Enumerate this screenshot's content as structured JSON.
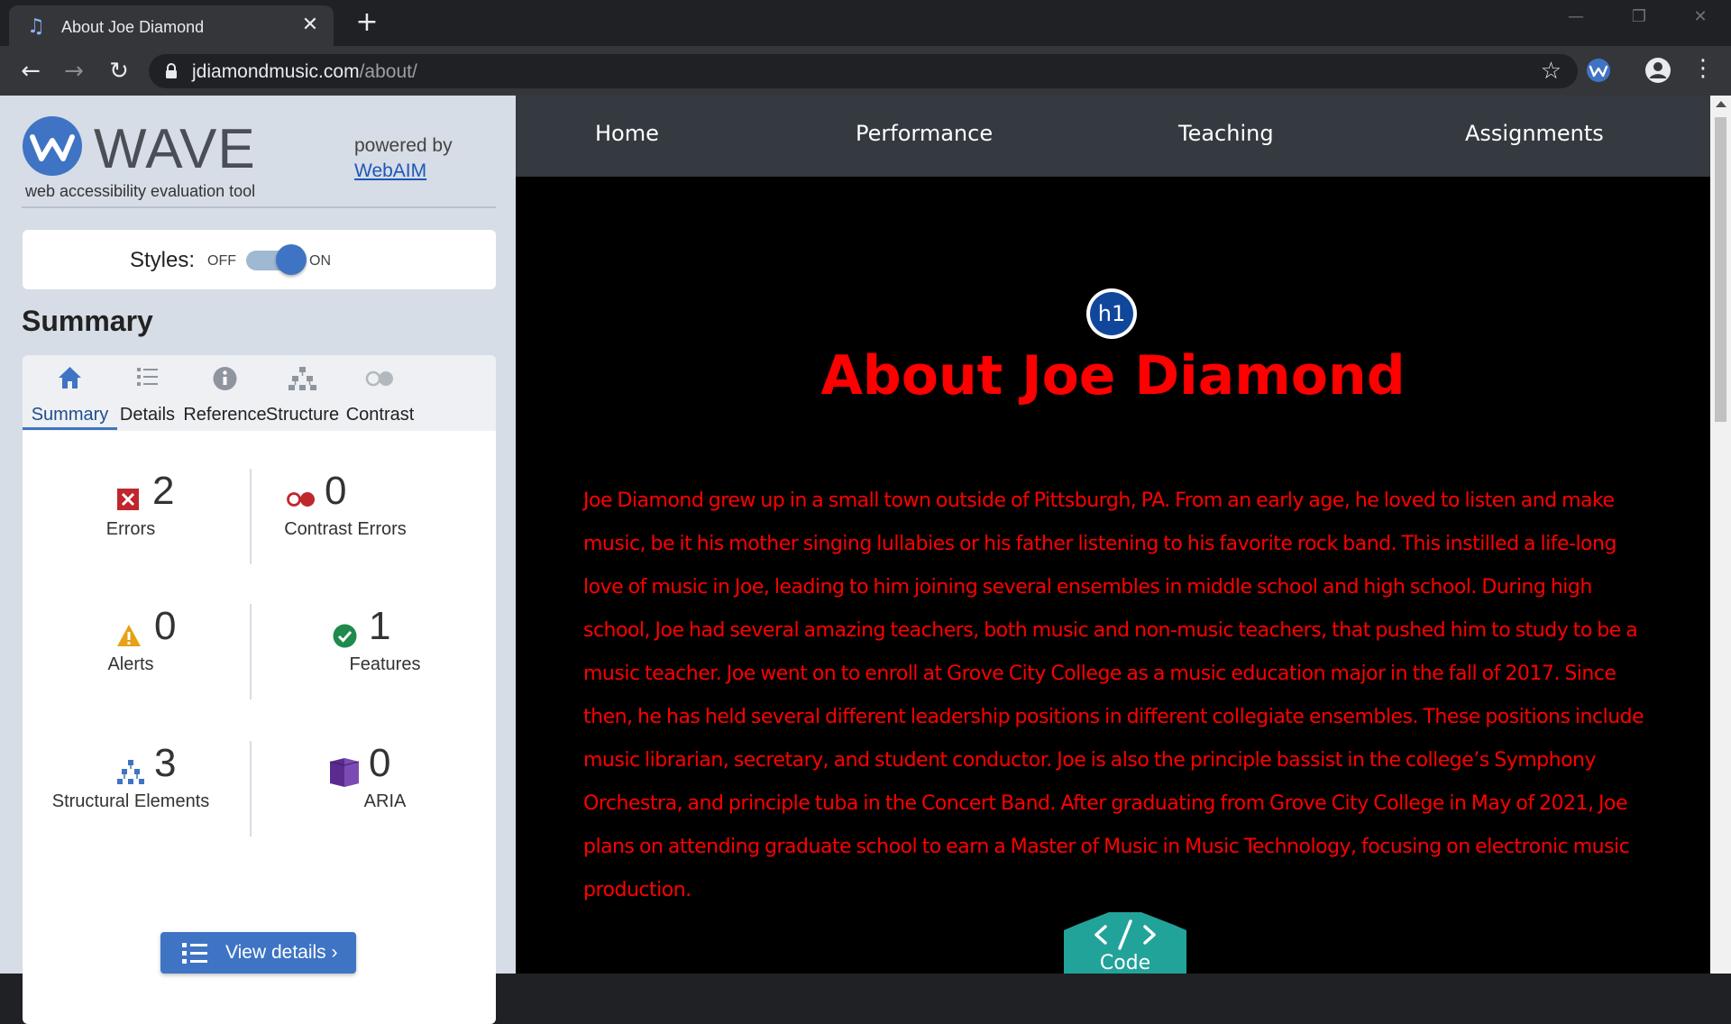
{
  "browser": {
    "tab_title": "About Joe Diamond",
    "url_host": "jdiamondmusic.com",
    "url_path": "/about/"
  },
  "wave": {
    "wordmark": "WAVE",
    "tagline": "web accessibility evaluation tool",
    "powered_by": "powered by",
    "webaim_link": "WebAIM",
    "styles_label": "Styles:",
    "styles_off": "OFF",
    "styles_on": "ON",
    "styles_enabled": true,
    "summary_heading": "Summary",
    "tabs": [
      {
        "label": "Summary",
        "icon": "home-icon",
        "active": true
      },
      {
        "label": "Details",
        "icon": "list-icon",
        "active": false
      },
      {
        "label": "Reference",
        "icon": "info-icon",
        "active": false
      },
      {
        "label": "Structure",
        "icon": "hierarchy-icon",
        "active": false
      },
      {
        "label": "Contrast",
        "icon": "contrast-icon",
        "active": false
      }
    ],
    "stats": {
      "errors": {
        "count": "2",
        "label": "Errors",
        "color": "#c0272d"
      },
      "contrast_errors": {
        "count": "0",
        "label": "Contrast Errors",
        "color": "#c0272d"
      },
      "alerts": {
        "count": "0",
        "label": "Alerts",
        "color": "#e6a117"
      },
      "features": {
        "count": "1",
        "label": "Features",
        "color": "#1e8a4c"
      },
      "structural": {
        "count": "3",
        "label": "Structural Elements",
        "color": "#3f74c4"
      },
      "aria": {
        "count": "0",
        "label": "ARIA",
        "color": "#5a2c8f"
      }
    },
    "view_details_label": "View details ›"
  },
  "site": {
    "nav": [
      "Home",
      "Performance",
      "Teaching",
      "Assignments"
    ],
    "h1_badge": "h1",
    "title": "About Joe Diamond",
    "bio": "Joe Diamond grew up in a small town outside of Pittsburgh, PA. From an early age, he loved to listen and make music, be it his mother singing lullabies or his father listening to his favorite rock band. This instilled a life-long love of music in Joe, leading to him joining several ensembles in middle school and high school. During high school, Joe had several amazing teachers, both music and non-music teachers, that pushed him to study to be a music teacher. Joe went on to enroll at Grove City College as a music education major in the fall of 2017. Since then, he has held several different leadership positions in different collegiate ensembles. These positions include music librarian, secretary, and student conductor. Joe is also the principle bassist in the college’s Symphony Orchestra, and principle tuba in the Concert Band. After graduating from Grove City College in May of 2021, Joe plans on attending graduate school to earn a Master of Music in Music Technology, focusing on electronic music production.",
    "code_badge": "Code",
    "text_color": "#ff0000",
    "nav_bg": "#343a40"
  }
}
